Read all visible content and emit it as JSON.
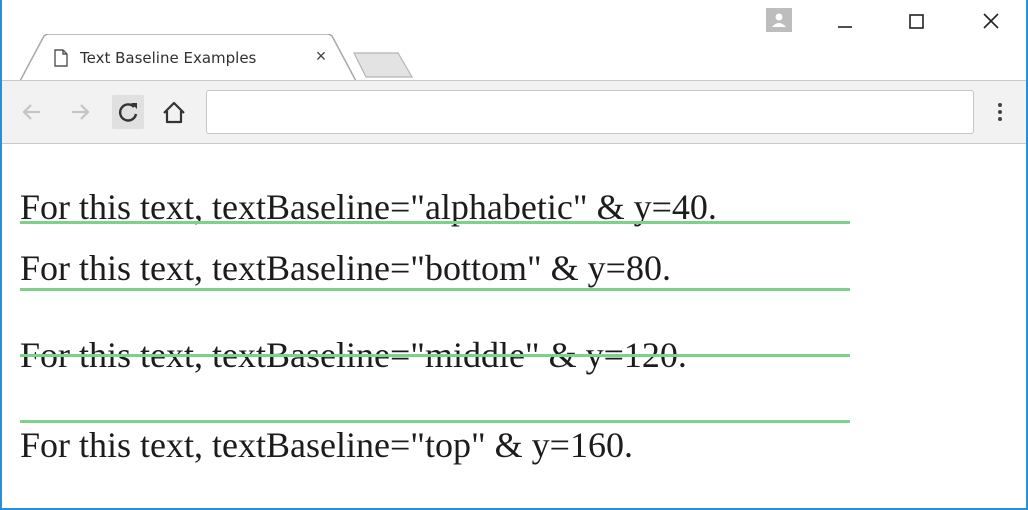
{
  "tab": {
    "title": "Text Baseline Examples",
    "close_glyph": "×"
  },
  "window_controls": {
    "minimize_glyph": "–",
    "maximize_glyph": "☐",
    "close_glyph": "✕"
  },
  "toolbar": {
    "back_icon": "arrow-left-icon",
    "forward_icon": "arrow-right-icon",
    "reload_icon": "reload-icon",
    "home_icon": "home-icon",
    "address_value": "",
    "menu_icon": "kebab-menu-icon"
  },
  "content": {
    "lines": [
      "For this text, textBaseline=\"alphabetic\" & y=40.",
      "For this text, textBaseline=\"bottom\" & y=80.",
      "For this text, textBaseline=\"middle\" & y=120.",
      "For this text, textBaseline=\"top\" & y=160."
    ],
    "guide_color": "#7fcf8f"
  },
  "colors": {
    "window_border": "#2b8fd6",
    "toolbar_bg": "#f2f2f2"
  }
}
